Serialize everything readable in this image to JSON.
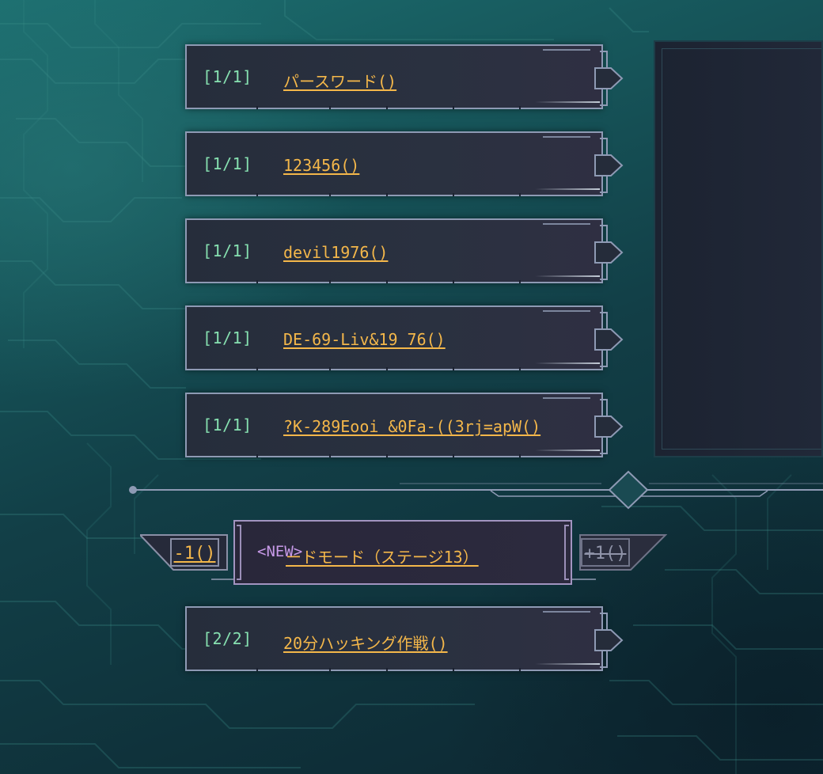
{
  "password_list": [
    {
      "count": "[1/1]",
      "title": "パースワード()"
    },
    {
      "count": "[1/1]",
      "title": "123456()"
    },
    {
      "count": "[1/1]",
      "title": "devil1976()"
    },
    {
      "count": "[1/1]",
      "title": "DE-69-Liv&19_76()"
    },
    {
      "count": "[1/1]",
      "title": "?K-289Eooi_&0Fa-((3rj=apW()"
    }
  ],
  "mode_selector": {
    "decrement_label": "-1()",
    "increment_label": "+1()",
    "new_badge": "<NEW>",
    "mode_title": "ードモード（ステージ13）"
  },
  "mission": {
    "count": "[2/2]",
    "title": "20分ハッキング作戦()"
  },
  "colors": {
    "count_text": "#86e0b0",
    "title_link": "#f4b74a",
    "new_badge": "#c79ae8",
    "card_border": "#8e9ab4"
  }
}
